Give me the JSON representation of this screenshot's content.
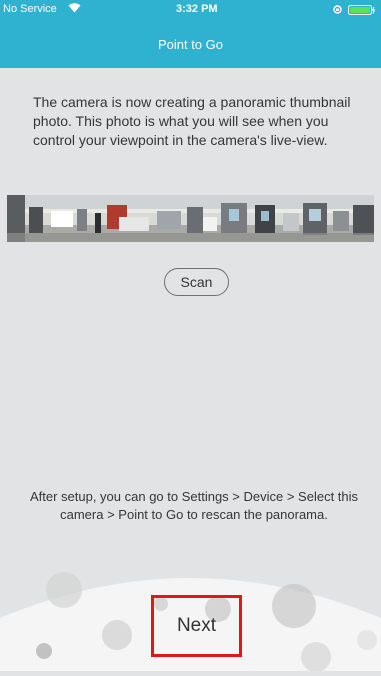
{
  "status_bar": {
    "carrier": "No Service",
    "time": "3:32 PM",
    "wifi_icon": "wifi-icon",
    "lock_icon": "orientation-lock-icon",
    "battery_icon": "battery-icon",
    "accent_color": "#2eb2cf",
    "battery_color": "#5be25b"
  },
  "nav": {
    "title": "Point to Go"
  },
  "main": {
    "intro_text": "The camera is now creating a panoramic thumbnail photo. This photo is what you will see when you control your viewpoint in the camera's live-view.",
    "scan_label": "Scan",
    "setup_note": "After setup, you can go to Settings > Device > Select this camera > Point to Go to rescan the panorama."
  },
  "footer": {
    "next_label": "Next",
    "highlight_color": "#e01818"
  }
}
